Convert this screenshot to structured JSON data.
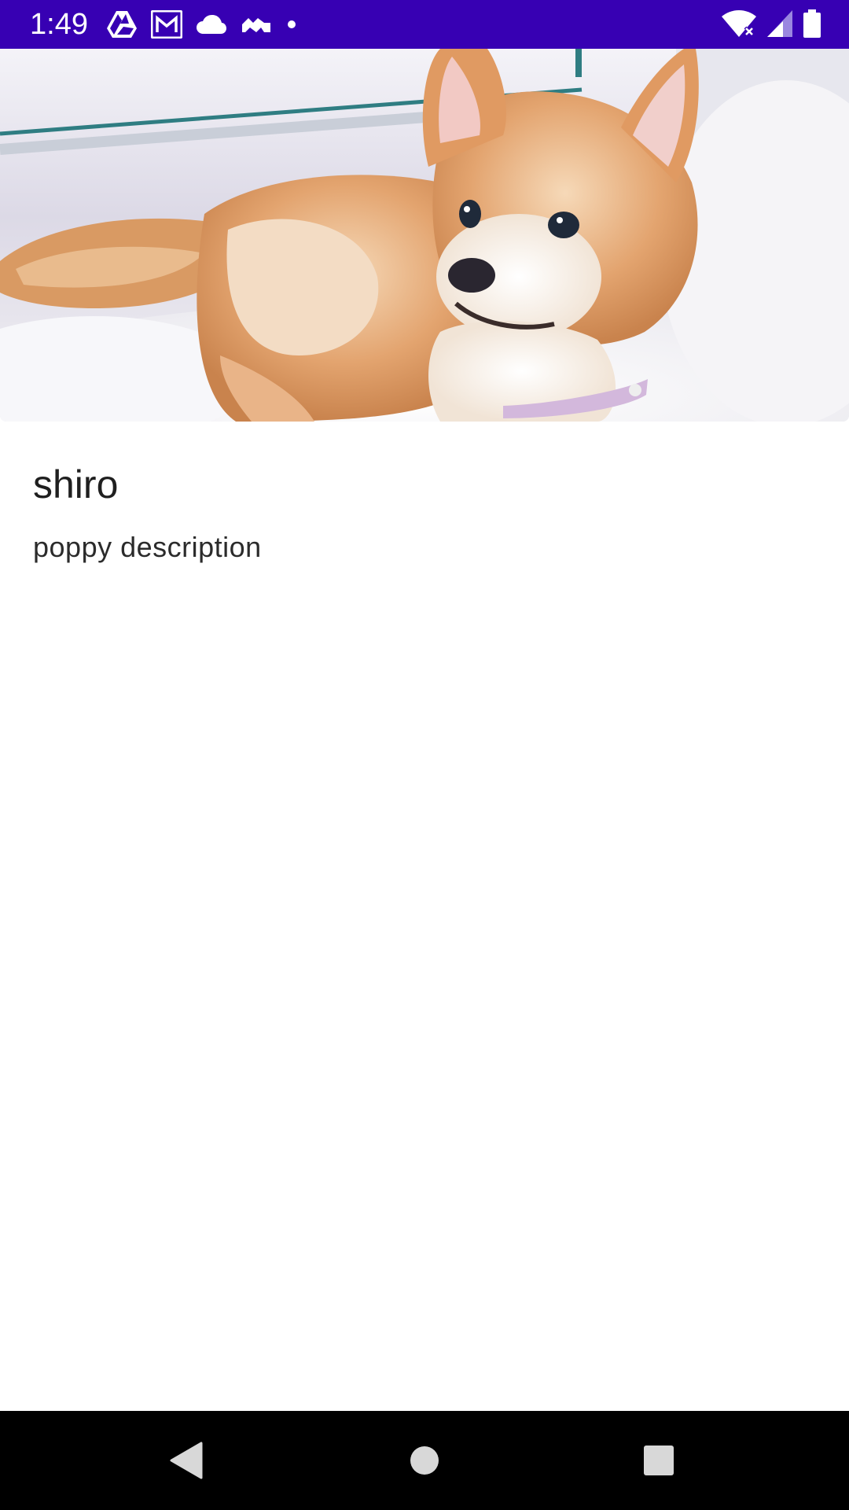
{
  "status_bar": {
    "time": "1:49",
    "background_color": "#3700b3",
    "left_icons": [
      "drive-icon",
      "gmail-icon",
      "cloud-icon",
      "cloud-sync-icon",
      "notification-dot-icon"
    ],
    "right_icons": [
      "wifi-icon",
      "cell-signal-icon",
      "battery-icon"
    ]
  },
  "hero": {
    "image_subject": "shiba-inu-puppy",
    "icon": "dog-photo"
  },
  "content": {
    "title": "shiro",
    "description": "poppy description"
  },
  "nav_bar": {
    "buttons": [
      "back-icon",
      "home-icon",
      "recents-icon"
    ]
  }
}
